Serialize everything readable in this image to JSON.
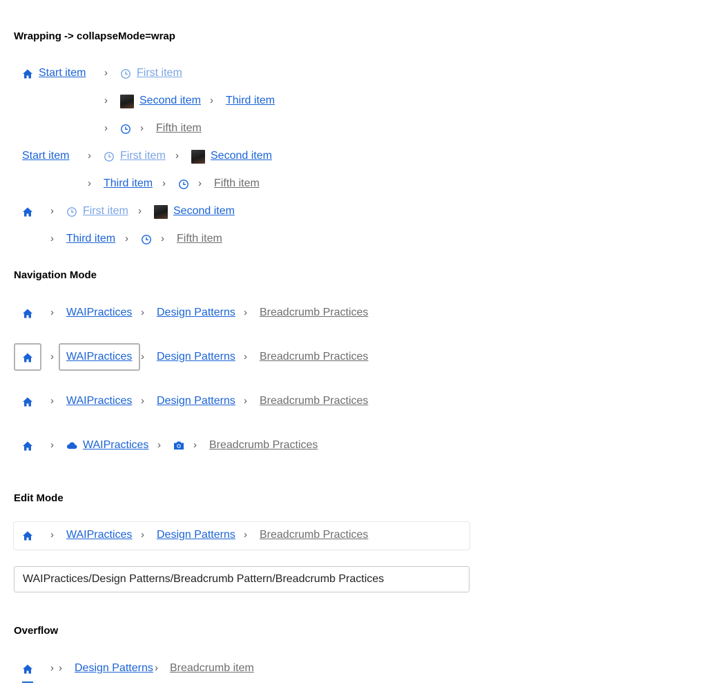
{
  "sections": {
    "wrapping": "Wrapping -> collapseMode=wrap",
    "navigation": "Navigation Mode",
    "edit": "Edit Mode",
    "overflow": "Overflow"
  },
  "wrap_items": {
    "start": "Start item",
    "first": "First item",
    "second": "Second item",
    "third": "Third item",
    "fifth": "Fifth item"
  },
  "nav_items": {
    "wai": "WAIPractices",
    "design": "Design Patterns",
    "breadcrumb": "Breadcrumb Practices"
  },
  "edit": {
    "input_value": "WAIPractices/Design Patterns/Breadcrumb Pattern/Breadcrumb Practices"
  },
  "overflow": {
    "design": "Design Patterns",
    "item": "Breadcrumb item"
  },
  "separator": "›",
  "icons": {
    "home": "home-icon",
    "clock": "clock-icon",
    "avatar": "avatar-image",
    "cloud": "cloud-icon",
    "camera": "camera-icon"
  },
  "colors": {
    "link": "#1a63d6",
    "link_disabled": "#7aa4e4",
    "current": "#6e6e6e"
  }
}
